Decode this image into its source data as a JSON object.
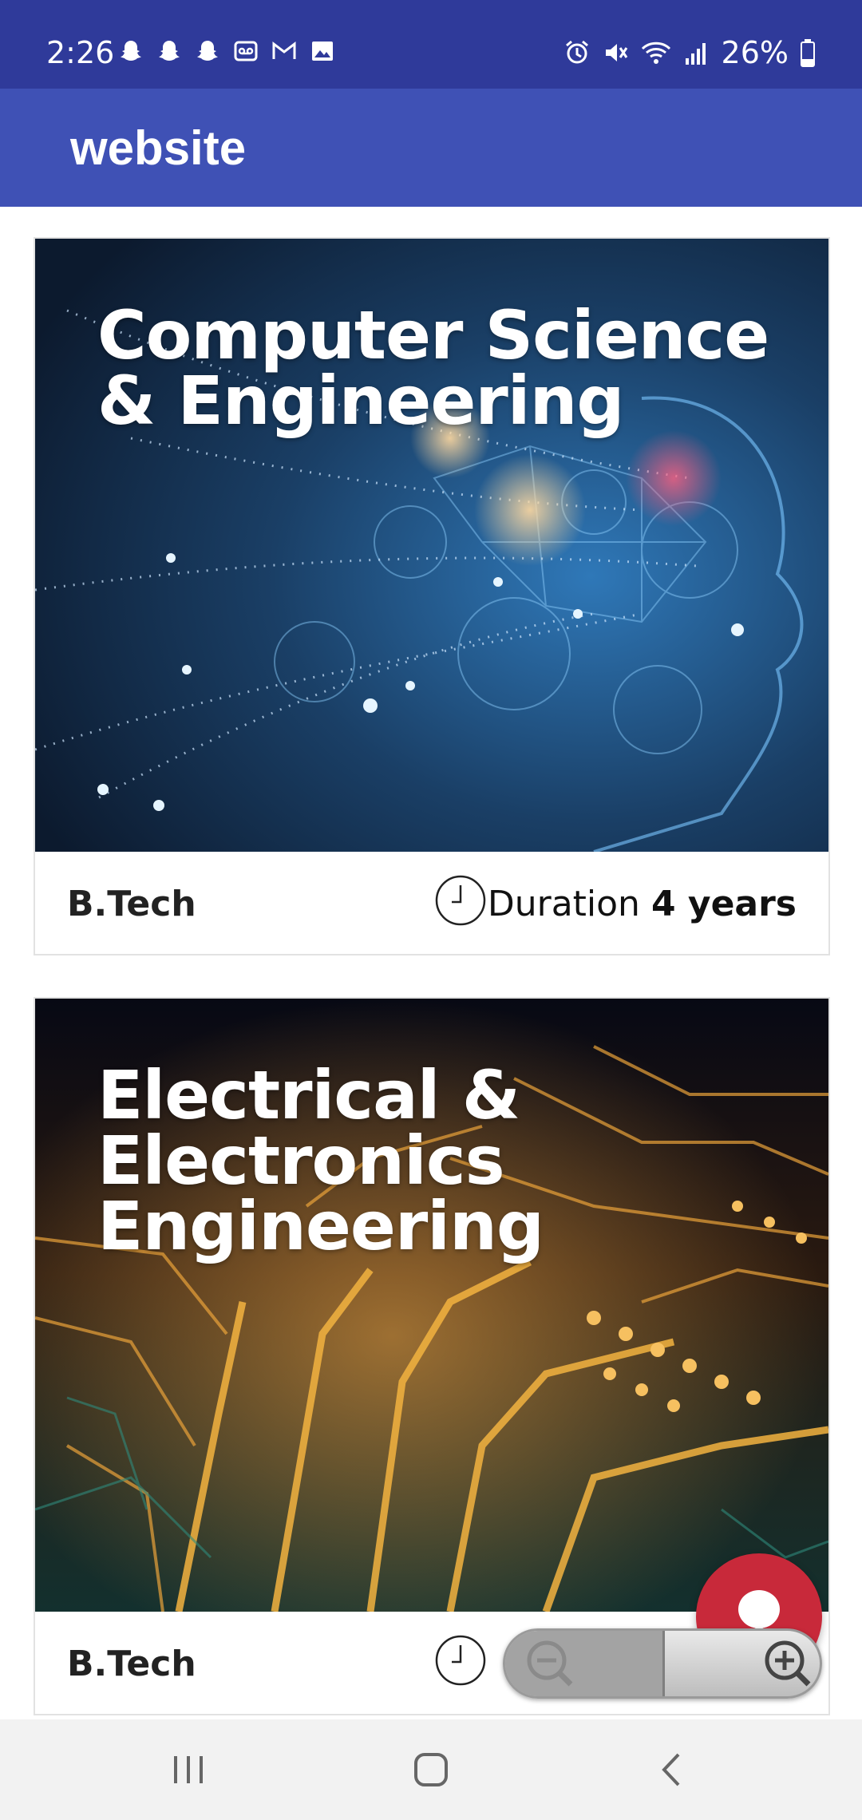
{
  "status_bar": {
    "time": "2:26",
    "battery": "26%",
    "left_icons": [
      "snapchat-icon",
      "snapchat-icon",
      "snapchat-icon",
      "voicemail-icon",
      "gmail-icon",
      "image-icon"
    ],
    "right_icons": [
      "alarm-icon",
      "mute-icon",
      "wifi-icon",
      "signal-icon",
      "battery-icon"
    ]
  },
  "app_bar": {
    "title": "website"
  },
  "courses": [
    {
      "title_line1": "Computer Science",
      "title_line2": "& Engineering",
      "title_line3": "",
      "degree": "B.Tech",
      "duration_label": "Duration",
      "duration_value": "4 years"
    },
    {
      "title_line1": "Electrical &",
      "title_line2": "Electronics",
      "title_line3": "Engineering",
      "degree": "B.Tech"
    }
  ],
  "colors": {
    "status_bar": "#2f3a9a",
    "app_bar": "#3f51b5",
    "chat_fab": "#c8293a"
  },
  "nav": {
    "icons": [
      "recent-apps-icon",
      "home-icon",
      "back-icon"
    ]
  }
}
